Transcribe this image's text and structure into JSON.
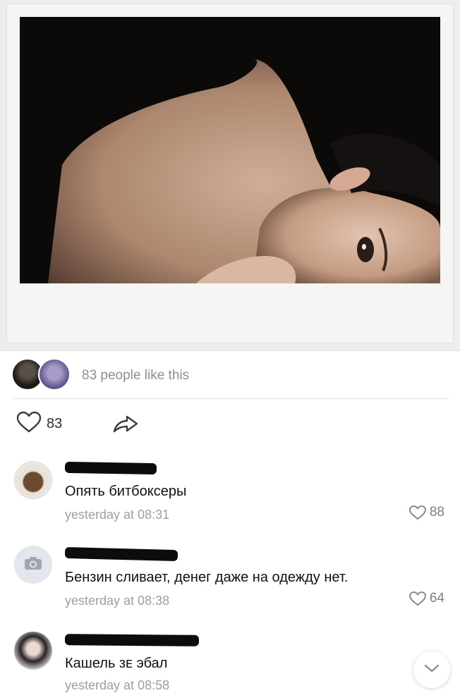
{
  "post": {
    "likes_summary": "83 people like this",
    "like_count": "83"
  },
  "comments": [
    {
      "text": "Опять битбоксеры",
      "time": "yesterday at 08:31",
      "likes": "88"
    },
    {
      "text": "Бензин сливает, денег даже на одежду нет.",
      "time": "yesterday at 08:38",
      "likes": "64"
    },
    {
      "text": "Кашель зᴇ эбал",
      "time": "yesterday at 08:58",
      "likes": ""
    }
  ],
  "icons": {
    "like": "heart-outline-icon",
    "share": "share-arrow-icon",
    "camera": "camera-icon",
    "scroll": "chevron-down-icon"
  },
  "colors": {
    "accent": "#8a8f96",
    "muted": "#9aa0a8"
  }
}
